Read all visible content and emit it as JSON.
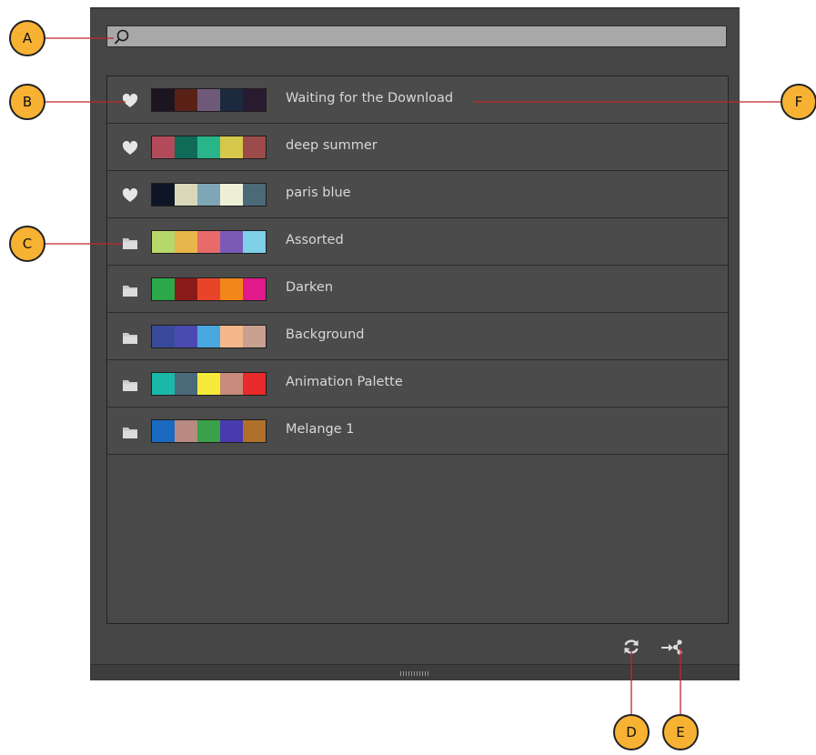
{
  "search": {
    "value": "",
    "icon": "search-icon"
  },
  "palettes": [
    {
      "type": "favorite",
      "icon": "heart-icon",
      "name": "Waiting for the Download",
      "colors": [
        "#1c1520",
        "#5a2116",
        "#6e5a78",
        "#1c2a40",
        "#2a1a30"
      ]
    },
    {
      "type": "favorite",
      "icon": "heart-icon",
      "name": "deep summer",
      "colors": [
        "#b24a5a",
        "#0f6a58",
        "#28b58a",
        "#d6c84a",
        "#9c4a4a"
      ]
    },
    {
      "type": "favorite",
      "icon": "heart-icon",
      "name": "paris blue",
      "colors": [
        "#0e1626",
        "#d8d8b8",
        "#7ea6b6",
        "#eef0d6",
        "#4a6a78"
      ]
    },
    {
      "type": "folder",
      "icon": "folder-icon",
      "name": "Assorted",
      "colors": [
        "#b6d86a",
        "#e8b64a",
        "#e86a6a",
        "#7a5ab6",
        "#7ed0e8"
      ]
    },
    {
      "type": "folder",
      "icon": "folder-icon",
      "name": "Darken",
      "colors": [
        "#2aa84a",
        "#8a1a1a",
        "#e8442a",
        "#f2861a",
        "#e01a8a"
      ]
    },
    {
      "type": "folder",
      "icon": "folder-icon",
      "name": "Background",
      "colors": [
        "#3a4a9a",
        "#4a4ab0",
        "#4aa8e0",
        "#f6b88a",
        "#caa090"
      ]
    },
    {
      "type": "folder",
      "icon": "folder-icon",
      "name": "Animation Palette",
      "colors": [
        "#1ab8a8",
        "#4a6a7a",
        "#f6ea3a",
        "#c88a7a",
        "#e82a2a"
      ]
    },
    {
      "type": "folder",
      "icon": "folder-icon",
      "name": "Melange 1",
      "colors": [
        "#1a6ac0",
        "#b88a80",
        "#3aa04a",
        "#4a3ab0",
        "#b0702a"
      ]
    }
  ],
  "footer": {
    "refresh_icon": "refresh-icon",
    "share_icon": "share-icon"
  },
  "callouts": {
    "a": "A",
    "b": "B",
    "c": "C",
    "d": "D",
    "e": "E",
    "f": "F"
  },
  "colors": {
    "panel": "#464646",
    "callout": "#f7b233",
    "leader": "#c0262c"
  }
}
